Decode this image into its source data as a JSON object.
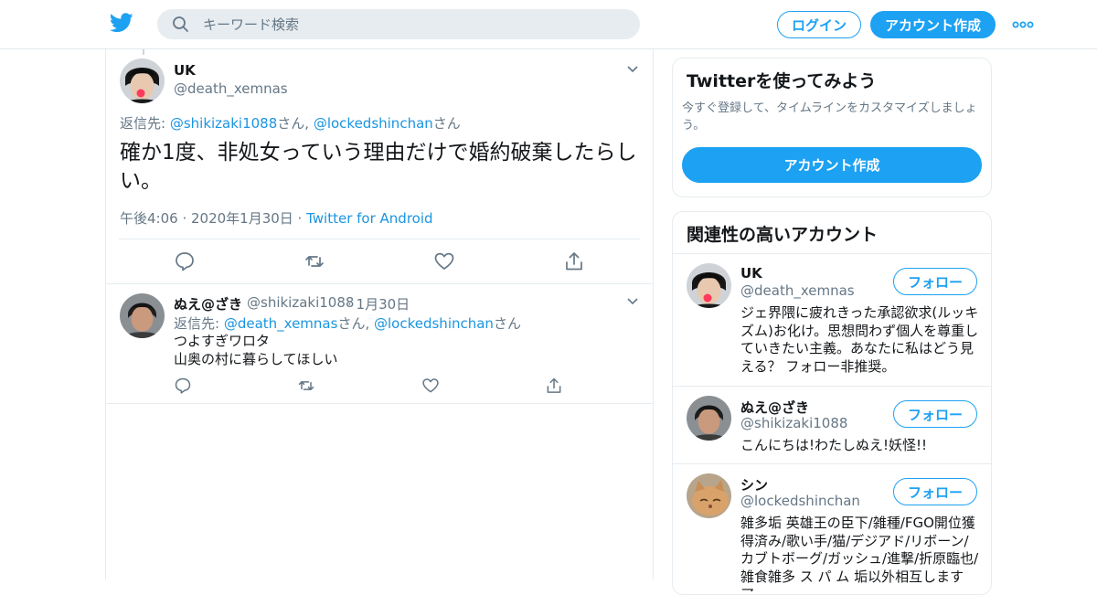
{
  "header": {
    "logo_icon": "twitter-bird-icon",
    "search_placeholder": "キーワード検索",
    "login_label": "ログイン",
    "signup_label": "アカウント作成",
    "more_icon": "more-dots-icon"
  },
  "main_tweet": {
    "name": "UK",
    "handle": "@death_xemnas",
    "reply_prefix": "返信先: ",
    "reply_users": [
      "@shikizaki1088",
      "@lockedshinchan"
    ],
    "reply_suffix": "さん",
    "reply_sep": ", ",
    "text": "確か1度、非処女っていう理由だけで婚約破棄したらしい。",
    "time": "午後4:06 · 2020年1月30日 · ",
    "source": "Twitter for Android"
  },
  "reply_tweet": {
    "name": "ぬえ@ざき",
    "handle": "@shikizaki1088",
    "date": "· 1月30日",
    "reply_prefix": "返信先: ",
    "reply_users": [
      "@death_xemnas",
      "@lockedshinchan"
    ],
    "reply_suffix": "さん",
    "reply_sep": ", ",
    "text_line1": "つよすぎワロタ",
    "text_line2": "山奥の村に暮らしてほしい"
  },
  "sidebar": {
    "signup_card": {
      "title": "Twitterを使ってみよう",
      "description": "今すぐ登録して、タイムラインをカスタマイズしましょう。",
      "button": "アカウント作成"
    },
    "related": {
      "title": "関連性の高いアカウント",
      "follow_label": "フォロー",
      "accounts": [
        {
          "name": "UK",
          "handle": "@death_xemnas",
          "bio": "ジェ界隈に疲れきった承認欲求(ルッキズム)お化け。思想問わず個人を尊重していきたい主義。あなたに私はどう見える？ フォロー非推奨。"
        },
        {
          "name": "ぬえ@ざき",
          "handle": "@shikizaki1088",
          "bio": "こんにちは!わたしぬえ!妖怪!!"
        },
        {
          "name": "シン",
          "handle": "@lockedshinchan",
          "bio": "雑多垢 英雄王の臣下/雑種/FGO開位獲得済み/歌い手/猫/デジアド/リボーン/カブトボーグ/ガッシュ/進撃/折原臨也/雑食雑多 ス パ ム 垢以外相互します ア"
        }
      ]
    }
  },
  "colors": {
    "accent": "#1da1f2",
    "link": "#1b95e0",
    "muted": "#657786",
    "border": "#e6ecf0"
  }
}
